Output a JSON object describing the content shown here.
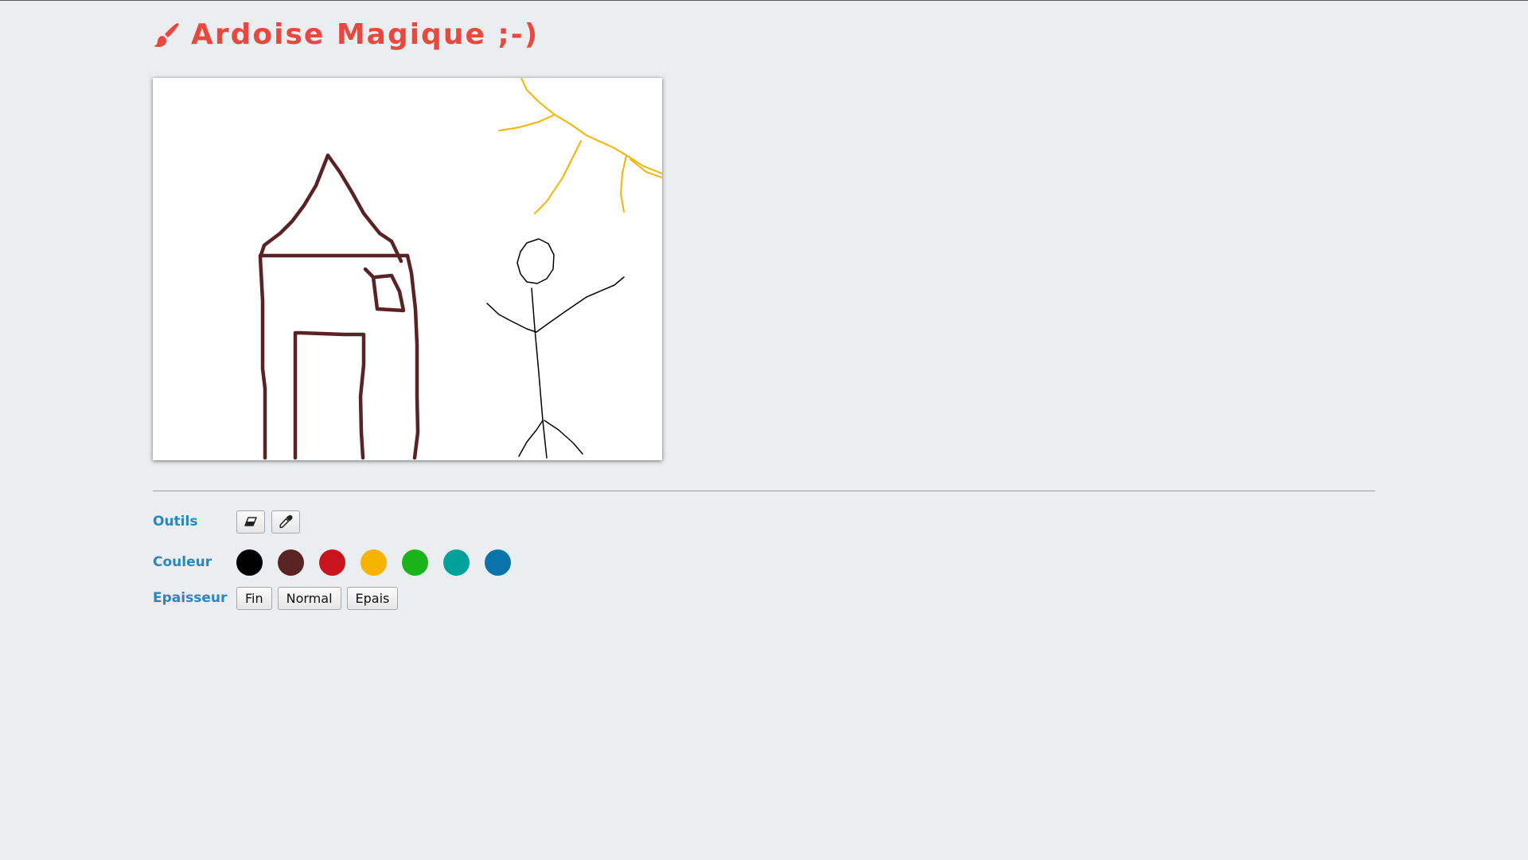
{
  "header": {
    "title": "Ardoise Magique ;-)",
    "icon": "paintbrush-icon",
    "accent_color": "#e9483f"
  },
  "canvas": {
    "background": "#ffffff",
    "strokes": [
      {
        "name": "house",
        "color": "#5a2323"
      },
      {
        "name": "sun",
        "color": "#f5b400"
      },
      {
        "name": "stick-figure",
        "color": "#000000"
      }
    ]
  },
  "toolbar": {
    "tools_label": "Outils",
    "tools": [
      {
        "icon": "eraser-icon"
      },
      {
        "icon": "eyedropper-icon"
      }
    ],
    "colors_label": "Couleur",
    "colors": [
      "#000000",
      "#5a2323",
      "#c8141e",
      "#f5b400",
      "#1ab41a",
      "#00a09b",
      "#0a73aa"
    ],
    "thickness_label": "Epaisseur",
    "thickness_options": [
      "Fin",
      "Normal",
      "Epais"
    ]
  }
}
